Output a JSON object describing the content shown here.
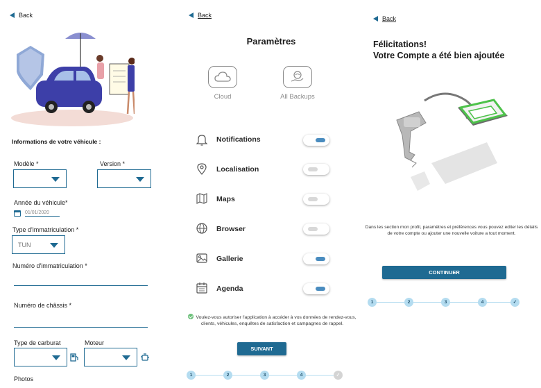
{
  "screen1": {
    "back_label": "Back",
    "section_heading": "Informations de votre véhicule :",
    "modele_label": "Modèle *",
    "version_label": "Version *",
    "annee_label": "Année du véhicule*",
    "annee_value": "01/01/2020",
    "type_immat_label": "Type d'immatriculation *",
    "type_immat_value": "TUN",
    "numero_immat_label": "Numéro d'immatriculation *",
    "numero_chassis_label": "Numéro de châssis *",
    "carburant_label": "Type de carburat",
    "moteur_label": "Moteur",
    "photos_label": "Photos"
  },
  "screen2": {
    "back_label": "Back",
    "title": "Paramètres",
    "cloud_label": "Cloud",
    "backups_label": "All Backups",
    "settings": [
      {
        "label": "Notifications",
        "on": true
      },
      {
        "label": "Localisation",
        "on": false
      },
      {
        "label": "Maps",
        "on": false
      },
      {
        "label": "Browser",
        "on": false
      },
      {
        "label": "Gallerie",
        "on": true
      },
      {
        "label": "Agenda",
        "on": true
      }
    ],
    "consent_text": "Voulez-vous autoriser l'application à accéder à vos données de rendez-vous, clients, véhicules, enquêtes de satisfaction et campagnes de rappel.",
    "next_button": "SUIVANT",
    "steps": [
      "1",
      "2",
      "3",
      "4"
    ]
  },
  "screen3": {
    "back_label": "Back",
    "title_line1": "Félicitations!",
    "title_line2": "Votre Compte a été bien ajoutée",
    "description": "Dans les section mon profil, paramètres et préférences vous pouvez editer les détails de votre compte ou ajouter une nouvelle voiture a tout moment.",
    "continue_button": "CONTINUER",
    "steps": [
      "1",
      "2",
      "3",
      "4"
    ]
  },
  "colors": {
    "primary": "#1f6a92",
    "accent_purple": "#3d3fa8",
    "toggle_on": "#4a8cbf",
    "step_circle": "#b4dcf0",
    "keyfob_green": "#4dc24a"
  }
}
